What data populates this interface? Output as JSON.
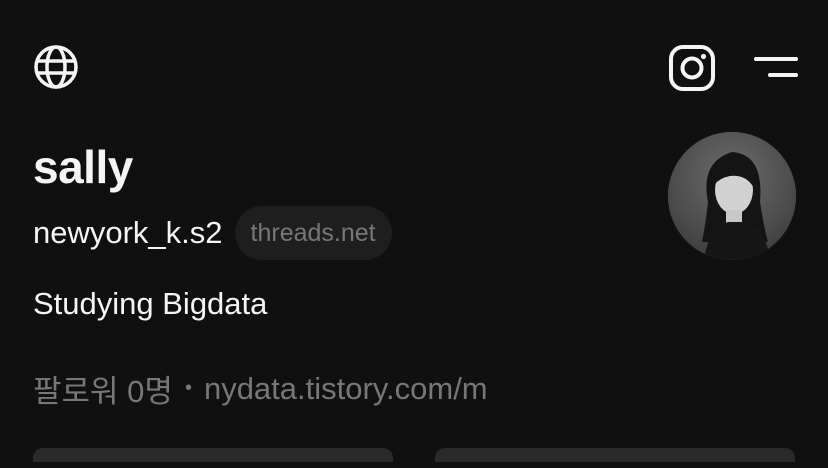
{
  "header": {
    "icons": [
      "globe-icon",
      "instagram-icon",
      "menu-icon"
    ]
  },
  "profile": {
    "name": "sally",
    "handle": "newyork_k.s2",
    "domain_chip": "threads.net",
    "bio": "Studying Bigdata",
    "followers": "팔로워 0명",
    "separator": "•",
    "link": "nydata.tistory.com/m"
  },
  "colors": {
    "background": "#101010",
    "primary_text": "#f3f5f7",
    "secondary_text": "#777777",
    "chip_bg": "#1e1e1e"
  }
}
